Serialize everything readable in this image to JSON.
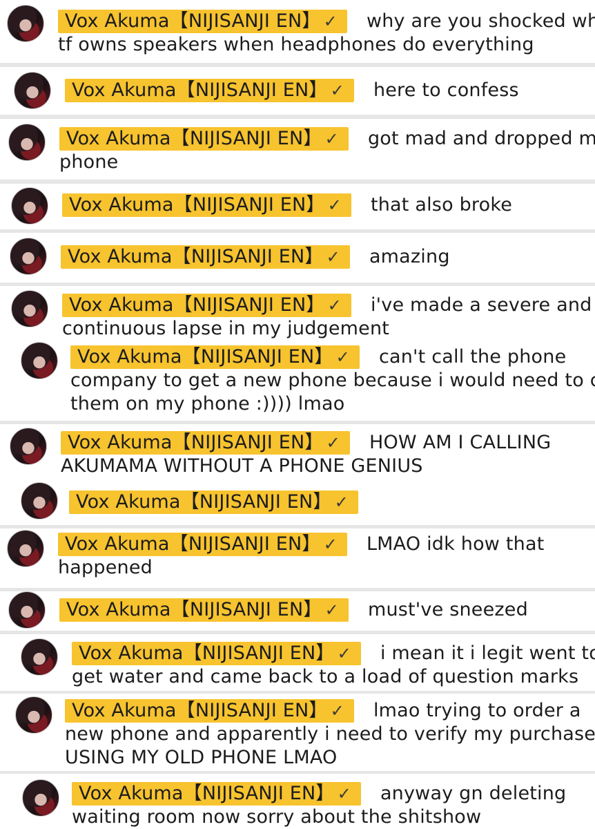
{
  "author": {
    "name": "Vox Akuma【NIJISANJI EN】",
    "verified_icon": "check-icon",
    "badge_color": "#f7c32e"
  },
  "messages": [
    {
      "lines": [
        "why are you shocked who",
        "tf owns speakers when headphones do everything"
      ]
    },
    {
      "lines": [
        "here to confess"
      ]
    },
    {
      "lines": [
        "got mad and dropped my",
        "phone"
      ]
    },
    {
      "lines": [
        "that also broke"
      ]
    },
    {
      "lines": [
        "amazing"
      ]
    },
    {
      "lines": [
        "i've made a severe and",
        "continuous lapse in my judgement"
      ]
    },
    {
      "lines": [
        "can't call the phone",
        "company to get a new phone because i would need to call",
        "them on my phone :)))) lmao"
      ]
    },
    {
      "lines": [
        "HOW AM I CALLING",
        "AKUMAMA WITHOUT A PHONE GENIUS"
      ]
    },
    {
      "lines": [
        ""
      ]
    },
    {
      "lines": [
        "LMAO idk how that",
        "happened"
      ]
    },
    {
      "lines": [
        "must've sneezed"
      ]
    },
    {
      "lines": [
        "i mean it i legit went to",
        "get water and came back to a load of question marks"
      ]
    },
    {
      "lines": [
        "lmao trying to order a",
        "new phone and apparently i need to verify my purchase",
        "USING MY OLD PHONE LMAO"
      ]
    },
    {
      "lines": [
        "anyway gn deleting",
        "waiting room now sorry about the shitshow"
      ]
    }
  ]
}
